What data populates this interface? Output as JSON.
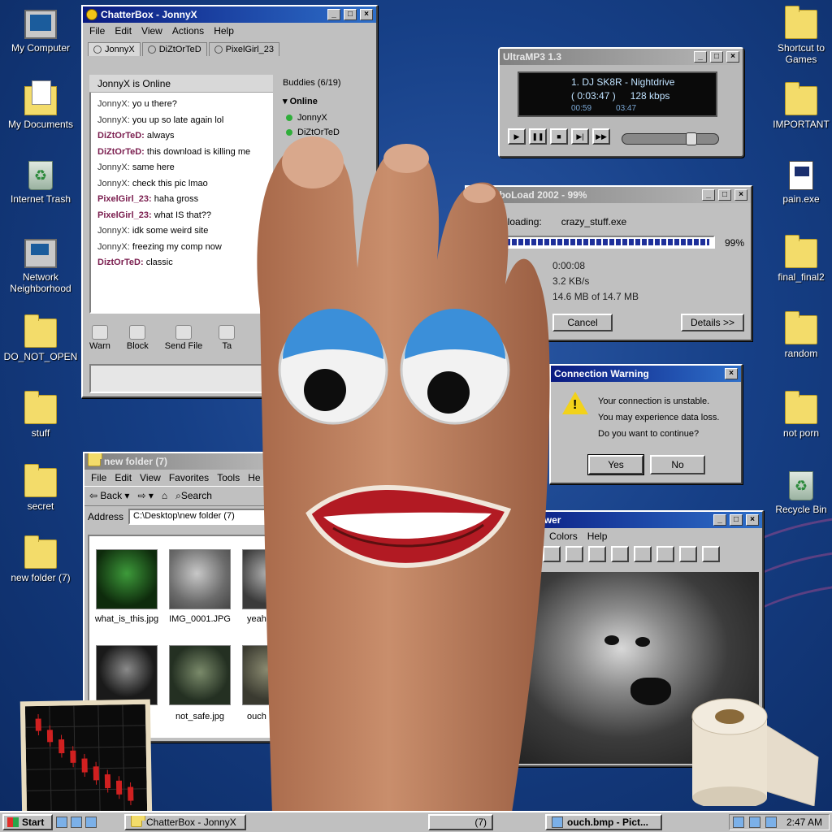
{
  "desktop_left": [
    {
      "label": "My Computer",
      "icon": "my-computer-icon"
    },
    {
      "label": "My Documents",
      "icon": "my-documents-icon"
    },
    {
      "label": "Internet Trash",
      "icon": "internet-trash-icon"
    },
    {
      "label": "Network Neighborhood",
      "icon": "network-neighborhood-icon"
    },
    {
      "label": "DO_NOT_OPEN",
      "icon": "folder-icon"
    },
    {
      "label": "stuff",
      "icon": "folder-icon"
    },
    {
      "label": "secret",
      "icon": "folder-icon"
    },
    {
      "label": "new folder (7)",
      "icon": "folder-icon"
    }
  ],
  "desktop_right": [
    {
      "label": "Shortcut to Games",
      "icon": "games-shortcut-icon"
    },
    {
      "label": "IMPORTANT",
      "icon": "folder-icon"
    },
    {
      "label": "pain.exe",
      "icon": "exe-icon"
    },
    {
      "label": "final_final2",
      "icon": "folder-icon"
    },
    {
      "label": "random",
      "icon": "folder-icon"
    },
    {
      "label": "not porn",
      "icon": "folder-icon"
    },
    {
      "label": "Recycle Bin",
      "icon": "recycle-bin-icon"
    }
  ],
  "chat": {
    "title": "ChatterBox - JonnyX",
    "menu": [
      "File",
      "Edit",
      "View",
      "Actions",
      "Help"
    ],
    "tabs": [
      "JonnyX",
      "DiZtOrTeD",
      "PixelGirl_23"
    ],
    "status": "JonnyX is Online",
    "messages": [
      {
        "nick": "JonnyX:",
        "text": "yo u there?",
        "other": false
      },
      {
        "nick": "JonnyX:",
        "text": "you up so late again lol",
        "other": false
      },
      {
        "nick": "DiZtOrTeD:",
        "text": "always",
        "other": true
      },
      {
        "nick": "DiZtOrTeD:",
        "text": "this download is killing me",
        "other": true
      },
      {
        "nick": "JonnyX:",
        "text": "same here",
        "other": false
      },
      {
        "nick": "JonnyX:",
        "text": "check this pic lmao",
        "other": false
      },
      {
        "nick": "PixelGirl_23:",
        "text": "haha gross",
        "other": true
      },
      {
        "nick": "PixelGirl_23:",
        "text": "what IS that??",
        "other": true
      },
      {
        "nick": "JonnyX:",
        "text": "idk some weird site",
        "other": false
      },
      {
        "nick": "JonnyX:",
        "text": "freezing my comp now",
        "other": false
      },
      {
        "nick": "DiztOrTeD:",
        "text": "classic",
        "other": true
      }
    ],
    "buddies_header": "Buddies (6/19)",
    "buddies_group": "Online",
    "buddies": [
      "JonnyX",
      "DiZtOrTeD"
    ],
    "tools": [
      "Warn",
      "Block",
      "Send File",
      "Ta"
    ]
  },
  "mp3": {
    "title": "UltraMP3 1.3",
    "track": "1. DJ SK8R - Nightdrive",
    "time": "( 0:03:47 )",
    "bitrate": "128 kbps",
    "elapsed": "00:59",
    "total": "03:47",
    "volume": 0.75,
    "controls": [
      "play",
      "pause",
      "stop",
      "next",
      "fast-forward"
    ]
  },
  "download": {
    "title": "TurboLoad 2002 - 99%",
    "label": "nloading:",
    "file": "crazy_stuff.exe",
    "progress": 0.99,
    "progress_text": "99%",
    "time_left": "0:00:08",
    "speed": "3.2 KB/s",
    "size": "14.6 MB of 14.7 MB",
    "cancel": "Cancel",
    "details": "Details >>"
  },
  "warning": {
    "title": "Connection Warning",
    "line1": "Your connection is unstable.",
    "line2": "You may experience data loss.",
    "line3": "Do you want to continue?",
    "yes": "Yes",
    "no": "No"
  },
  "explorer": {
    "title": "new folder (7)",
    "menu": [
      "File",
      "Edit",
      "View",
      "Favorites",
      "Tools",
      "He"
    ],
    "back": "Back",
    "search": "Search",
    "address_label": "Address",
    "address": "C:\\Desktop\\new folder (7)",
    "files": [
      "what_is_this.jpg",
      "IMG_0001.JPG",
      "yeah",
      "",
      "not_safe.jpg",
      "ouch"
    ]
  },
  "viewer": {
    "title": "Viewer",
    "menu": [
      "age",
      "Colors",
      "Help"
    ]
  },
  "taskbar": {
    "start": "Start",
    "tasks": [
      "ChatterBox - JonnyX",
      "(7)",
      "ouch.bmp - Pict..."
    ],
    "clock": "2:47 AM"
  },
  "colors": {
    "title_active": "#0a1a80",
    "chat_other_nick": "#7a1d4e",
    "progress_fill": "#1d2f9a"
  }
}
